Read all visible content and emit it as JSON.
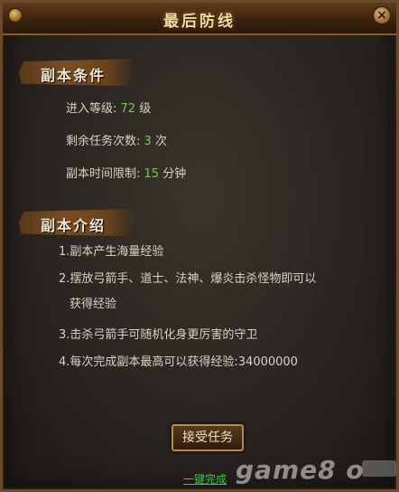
{
  "window": {
    "title": "最后防线",
    "close_glyph": "×"
  },
  "conditions": {
    "heading": "副本条件",
    "level_label": "进入等级:",
    "level_value": "72",
    "level_unit": "级",
    "count_label": "剩余任务次数:",
    "count_value": "3",
    "count_unit": "次",
    "time_label": "副本时间限制:",
    "time_value": "15",
    "time_unit": "分钟"
  },
  "intro": {
    "heading": "副本介绍",
    "items": [
      "1.副本产生海量经验",
      "2.摆放弓箭手、道士、法神、爆炎击杀怪物即可以",
      "获得经验",
      "3.击杀弓箭手可随机化身更厉害的守卫",
      "4.每次完成副本最高可以获得经验:34000000"
    ]
  },
  "actions": {
    "accept_label": "接受任务",
    "quick_complete_label": "一键完成"
  },
  "watermark": {
    "text": "game8 o"
  },
  "colors": {
    "accent_green": "#6fd04a",
    "title_gold": "#f3dca0",
    "frame_bronze": "#8a5a2a"
  }
}
